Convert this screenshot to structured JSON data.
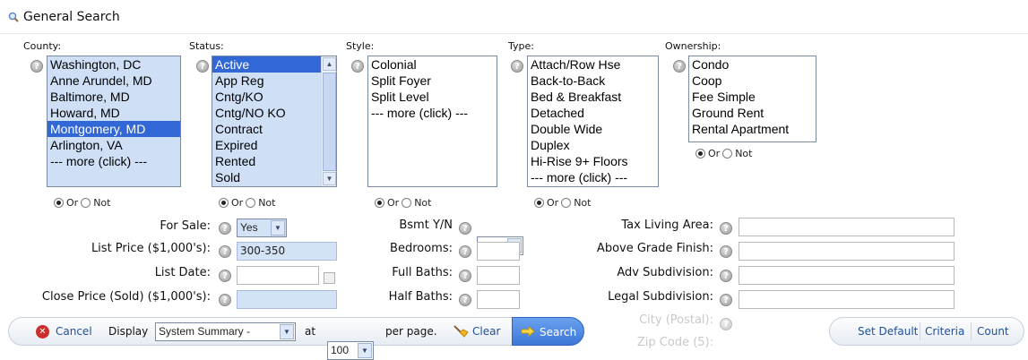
{
  "header": {
    "title": "General Search"
  },
  "county": {
    "label": "County:",
    "options": [
      "Washington, DC",
      "Anne Arundel, MD",
      "Baltimore, MD",
      "Howard, MD",
      "Montgomery, MD",
      "Arlington, VA",
      "--- more (click) ---"
    ],
    "selected_index": 4
  },
  "status": {
    "label": "Status:",
    "options": [
      "Active",
      "App Reg",
      "Cntg/KO",
      "Cntg/NO KO",
      "Contract",
      "Expired",
      "Rented",
      "Sold"
    ],
    "selected_index": 0
  },
  "style": {
    "label": "Style:",
    "options": [
      "Colonial",
      "Split Foyer",
      "Split Level",
      "--- more (click) ---"
    ]
  },
  "type": {
    "label": "Type:",
    "options": [
      "Attach/Row Hse",
      "Back-to-Back",
      "Bed & Breakfast",
      "Detached",
      "Double Wide",
      "Duplex",
      "Hi-Rise 9+ Floors",
      "--- more (click) ---"
    ]
  },
  "ownership": {
    "label": "Ownership:",
    "options": [
      "Condo",
      "Coop",
      "Fee Simple",
      "Ground Rent",
      "Rental Apartment"
    ]
  },
  "radio": {
    "or": "Or",
    "not": "Not"
  },
  "fields": {
    "for_sale_label": "For Sale:",
    "for_sale_value": "Yes",
    "list_price_label": "List Price ($1,000's):",
    "list_price_value": "300-350",
    "list_date_label": "List Date:",
    "close_price_label": "Close Price (Sold) ($1,000's):",
    "bsmt_label": "Bsmt Y/N",
    "bedrooms_label": "Bedrooms:",
    "full_baths_label": "Full Baths:",
    "half_baths_label": "Half Baths:",
    "tax_living_label": "Tax Living Area:",
    "above_grade_label": "Above Grade Finish:",
    "adv_subdivision_label": "Adv Subdivision:",
    "legal_subdivision_label": "Legal Subdivision:",
    "city_postal_label": "City (Postal):",
    "zip_label": "Zip Code (5):"
  },
  "toolbar": {
    "cancel": "Cancel",
    "display": "Display",
    "display_value": "System Summary -",
    "at": "at",
    "per_page_value": "100",
    "per_page": "per page.",
    "clear": "Clear",
    "search": "Search"
  },
  "rightbar": {
    "set_default": "Set Default",
    "criteria": "Criteria",
    "count": "Count"
  },
  "colors": {
    "accent": "#3168d5",
    "selection_bg": "#cfe0f6",
    "search_button": "#4a86e0",
    "cancel_icon": "#cc2d2d"
  }
}
